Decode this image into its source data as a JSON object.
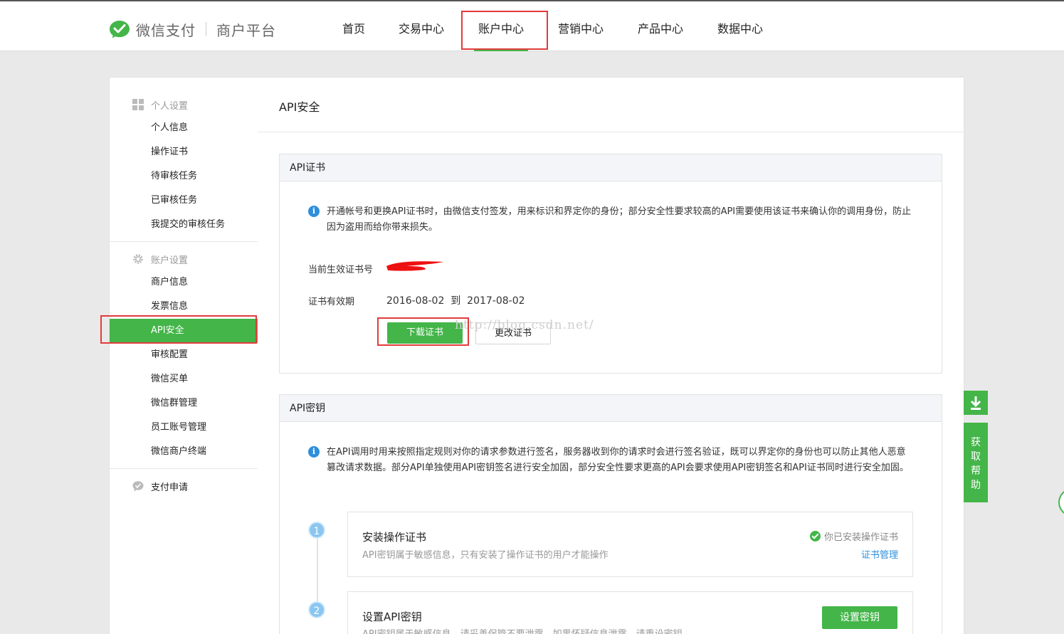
{
  "header": {
    "brand": "微信支付",
    "brand_sub": "商户平台",
    "nav": [
      "首页",
      "交易中心",
      "账户中心",
      "营销中心",
      "产品中心",
      "数据中心"
    ],
    "active_nav": "账户中心"
  },
  "sidebar": {
    "group_personal": "个人设置",
    "personal_items": [
      "个人信息",
      "操作证书",
      "待审核任务",
      "已审核任务",
      "我提交的审核任务"
    ],
    "group_account": "账户设置",
    "account_items": [
      "商户信息",
      "发票信息",
      "API安全",
      "审核配置",
      "微信买单",
      "微信群管理",
      "员工账号管理",
      "微信商户终端"
    ],
    "group_pay": "支付申请",
    "active_item": "API安全"
  },
  "main": {
    "title": "API安全",
    "cert_panel": {
      "title": "API证书",
      "info": "开通帐号和更换API证书时，由微信支付签发，用来标识和界定你的身份；部分安全性要求较高的API需要使用该证书来确认你的调用身份，防止因为盗用而给你带来损失。",
      "current_label": "当前生效证书号",
      "validity_label": "证书有效期",
      "validity_value": "2016-08-02  到  2017-08-02",
      "download_button": "下载证书",
      "change_button": "更改证书",
      "watermark": "http://blog.csdn.net/"
    },
    "key_panel": {
      "title": "API密钥",
      "info": "在API调用时用来按照指定规则对你的请求参数进行签名，服务器收到你的请求时会进行签名验证，既可以界定你的身份也可以防止其他人恶意篡改请求数据。部分API单独使用API密钥签名进行安全加固，部分安全性要求更高的API会要求使用API密钥签名和API证书同时进行安全加固。",
      "steps": [
        {
          "num": "1",
          "title": "安装操作证书",
          "desc": "API密钥属于敏感信息，只有安装了操作证书的用户才能操作",
          "status": "你已安装操作证书",
          "link": "证书管理"
        },
        {
          "num": "2",
          "title": "设置API密钥",
          "desc": "API密钥属于敏感信息，请妥善保管不要泄露，如果怀疑信息泄露，请重设密钥",
          "button": "设置密钥"
        }
      ]
    }
  },
  "floating": {
    "help": "获取帮助"
  },
  "colors": {
    "accent": "#44b549",
    "highlight": "#e23b3b",
    "info": "#2d8fdd"
  }
}
